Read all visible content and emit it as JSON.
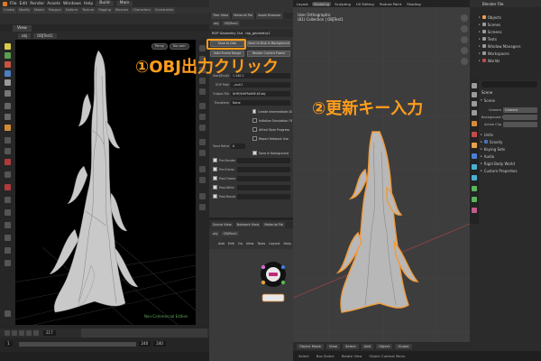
{
  "houdini": {
    "menu": [
      "File",
      "Edit",
      "Render",
      "Assets",
      "Windows",
      "Help"
    ],
    "build_label": "Build",
    "main_label": "Main",
    "shelf_tabs": [
      "Create",
      "Modify",
      "Model",
      "Polygon",
      "Deform",
      "Texture",
      "Rigging",
      "Muscles",
      "Characters",
      "Constraints",
      "Hair Utils",
      "Guide Process",
      "Terrain FX",
      "Cloud FX",
      "Volume"
    ],
    "view_tab": "View",
    "viewport_path": [
      "obj",
      "OBJTest1"
    ],
    "viewport_buttons": [
      "Persp",
      "No cam"
    ],
    "noncommercial": "Non-Commercial Edition",
    "frame_current": "217",
    "range_start": "1",
    "range_end": "240",
    "range_fps": "240"
  },
  "params": {
    "tabs": [
      "Tree View",
      "Material Pal",
      "Asset Browser"
    ],
    "path": [
      "obj",
      "OBJTest1"
    ],
    "node_type": "ROP Geometry Out",
    "node_name": "rop_geometry1",
    "save_to_disk": "Save to Disk",
    "save_bg": "Save to Disk in Background",
    "valid_frame_range": "Valid Frame Range",
    "render_current": "Render Current Frame",
    "rows": [
      {
        "label": "Start/End/Inc",
        "value": "1  240  1"
      },
      {
        "label": "SOP Path",
        "value": "../null1"
      },
      {
        "label": "Output File",
        "value": "$HIP/$HIPNAME.$F.obj"
      },
      {
        "label": "Transform",
        "value": "None"
      }
    ],
    "checks": [
      {
        "label": "Create Intermediate Directories",
        "on": true
      },
      {
        "label": "Initialize Simulation OPs",
        "on": false
      },
      {
        "label": "Alfred Style Progress",
        "on": false
      },
      {
        "label": "Report Network Use",
        "on": false
      }
    ],
    "save_retries_label": "Save Retries",
    "save_retries_value": "0",
    "save_background": "Save in Background",
    "scripts": [
      "Pre-Render Script",
      "Pre-Frame Script",
      "Post-Frame Script",
      "Post-Write Script",
      "Post-Render Script"
    ],
    "net_tabs": [
      "Scene View",
      "Network View",
      "Material Pal"
    ],
    "net_path": [
      "obj",
      "OBJTest1"
    ],
    "net_menu": [
      "Add",
      "Edit",
      "Go",
      "View",
      "Tools",
      "Layout",
      "Help"
    ]
  },
  "annotations": {
    "step1": "①OBJ出力クリック",
    "step2": "②更新キー入力"
  },
  "blender": {
    "workspace_tabs": [
      "Layout",
      "Modeling",
      "Sculpting",
      "UV Editing",
      "Texture Paint",
      "Shading"
    ],
    "active_tab": "Layout",
    "vp_title": "User Orthographic",
    "vp_subtitle": "(81) Collection | OBJTest1",
    "header_buttons": [
      "Object Mode",
      "View",
      "Select",
      "Add",
      "Object"
    ],
    "global_label": "Global",
    "status": [
      "Select",
      "Box Select",
      "Rotate View",
      "Object Context Menu"
    ],
    "outliner_title": "Blender File",
    "outliner_items": [
      "Objects",
      "Scenes",
      "Screens",
      "Texts",
      "Window Managers",
      "Workspaces",
      "Worlds"
    ],
    "props_scene_title": "Scene",
    "props": [
      {
        "k": "Camera",
        "v": "Camera"
      },
      {
        "k": "Background Sc...",
        "v": ""
      },
      {
        "k": "Active Clip",
        "v": ""
      }
    ],
    "sections": [
      {
        "t": "Units",
        "chk": false
      },
      {
        "t": "Gravity",
        "chk": true
      },
      {
        "t": "Keying Sets",
        "chk": false
      },
      {
        "t": "Audio",
        "chk": false
      },
      {
        "t": "Rigid Body World",
        "chk": false
      },
      {
        "t": "Custom Properties",
        "chk": false
      }
    ],
    "scene_section": "Scene"
  },
  "colors": {
    "annotation": "#ff9d1c",
    "mesh_grey": "#bdbdbd",
    "selection_orange": "#f19a3a"
  }
}
